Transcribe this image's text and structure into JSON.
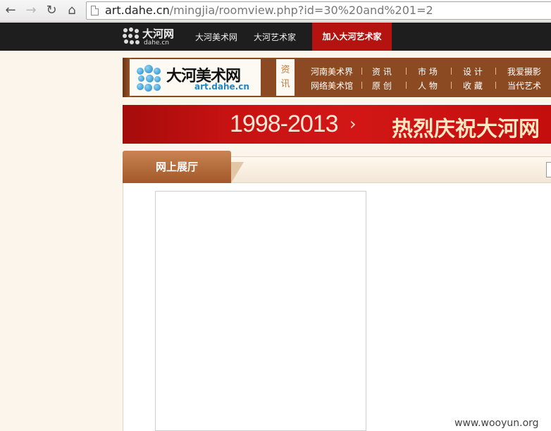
{
  "browser": {
    "back_icon": "←",
    "forward_icon": "→",
    "reload_icon": "↻",
    "home_icon": "⌂",
    "url_host": "art.dahe.cn",
    "url_path": "/mingjia/roomview.php?id=30%20and%201=2"
  },
  "topbar": {
    "logo_name": "大河网",
    "logo_sub": "dahe.cn",
    "links": [
      "大河美术网",
      "大河艺术家"
    ],
    "join_label": "加入大河艺术家"
  },
  "header": {
    "site_name": "大河美术网",
    "site_domain": "art.dahe.cn",
    "section_tab_line1": "资",
    "section_tab_line2": "讯",
    "nav_row1": [
      "河南美术界",
      "资 讯",
      "市 场",
      "设 计",
      "我爱摄影"
    ],
    "nav_row2": [
      "网络美术馆",
      "原 创",
      "人 物",
      "收 藏",
      "当代艺术"
    ]
  },
  "banner": {
    "years": "1998-2013",
    "arrow": "›",
    "slogan": "热烈庆祝大河网"
  },
  "gallery": {
    "tab_label": "网上展厅"
  },
  "watermark": "www.wooyun.org",
  "colors": {
    "topbar": "#1e1e1e",
    "join": "#b4130f",
    "header_band": "#8c4a22",
    "banner": "#c71212"
  }
}
